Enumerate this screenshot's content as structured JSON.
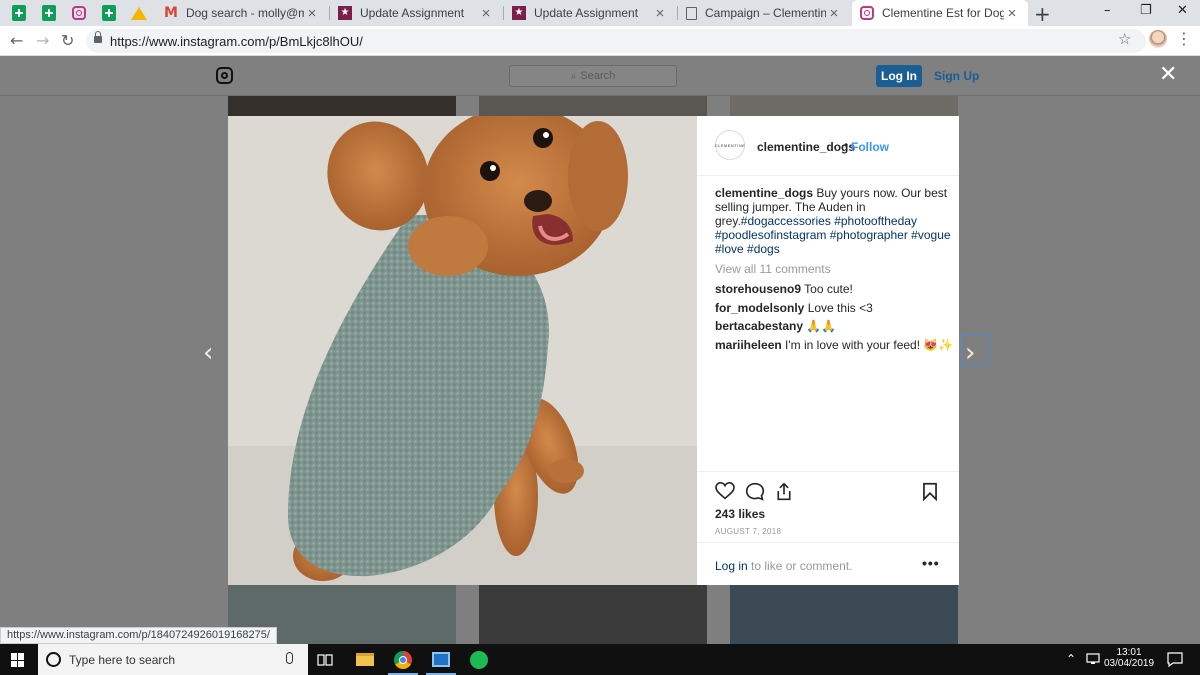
{
  "browser": {
    "tabs": [
      {
        "title": "Dog search - molly@modelsd",
        "icon": "gmail-icon"
      },
      {
        "title": "Update Assignment",
        "icon": "star-app-icon"
      },
      {
        "title": "Update Assignment",
        "icon": "star-app-icon"
      },
      {
        "title": "Campaign – Clementine Est. fo",
        "icon": "document-icon"
      },
      {
        "title": "Clementine Est for Dogs (@cle",
        "icon": "instagram-icon",
        "active": true
      }
    ],
    "new_tab": "+",
    "url": "https://www.instagram.com/p/BmLkjc8lhOU/",
    "window_controls": [
      "–",
      "❐",
      "✕"
    ]
  },
  "instagram": {
    "search_placeholder": "Search",
    "login_label": "Log In",
    "signup_label": "Sign Up",
    "close_label": "✕",
    "prev_arrow": "‹",
    "next_arrow": "›",
    "post": {
      "avatar_text": "CLEMENTINE",
      "username": "clementine_dogs",
      "separator": "•",
      "follow_label": "Follow",
      "caption_user": "clementine_dogs",
      "caption_text": "Buy yours now. Our best selling jumper. The Auden in grey.",
      "hashtags": [
        "#dogaccessories",
        "#photooftheday",
        "#poodlesofinstagram",
        "#photographer",
        "#vogue",
        "#love",
        "#dogs"
      ],
      "view_all": "View all 11 comments",
      "comments": [
        {
          "user": "storehouseno9",
          "text": "Too cute!"
        },
        {
          "user": "for_modelsonly",
          "text": "Love this <3"
        },
        {
          "user": "bertacabestany",
          "text": "🙏🙏"
        },
        {
          "user": "mariiheleen",
          "text": "I'm in love with your feed! 😻✨"
        }
      ],
      "likes": "243 likes",
      "date": "AUGUST 7, 2018",
      "login_link": "Log in",
      "login_suffix": "to like or comment.",
      "more": "•••"
    },
    "status_url": "https://www.instagram.com/p/1840724926019168275/"
  },
  "taskbar": {
    "search_placeholder": "Type here to search",
    "time": "13:01",
    "date": "03/04/2019"
  }
}
